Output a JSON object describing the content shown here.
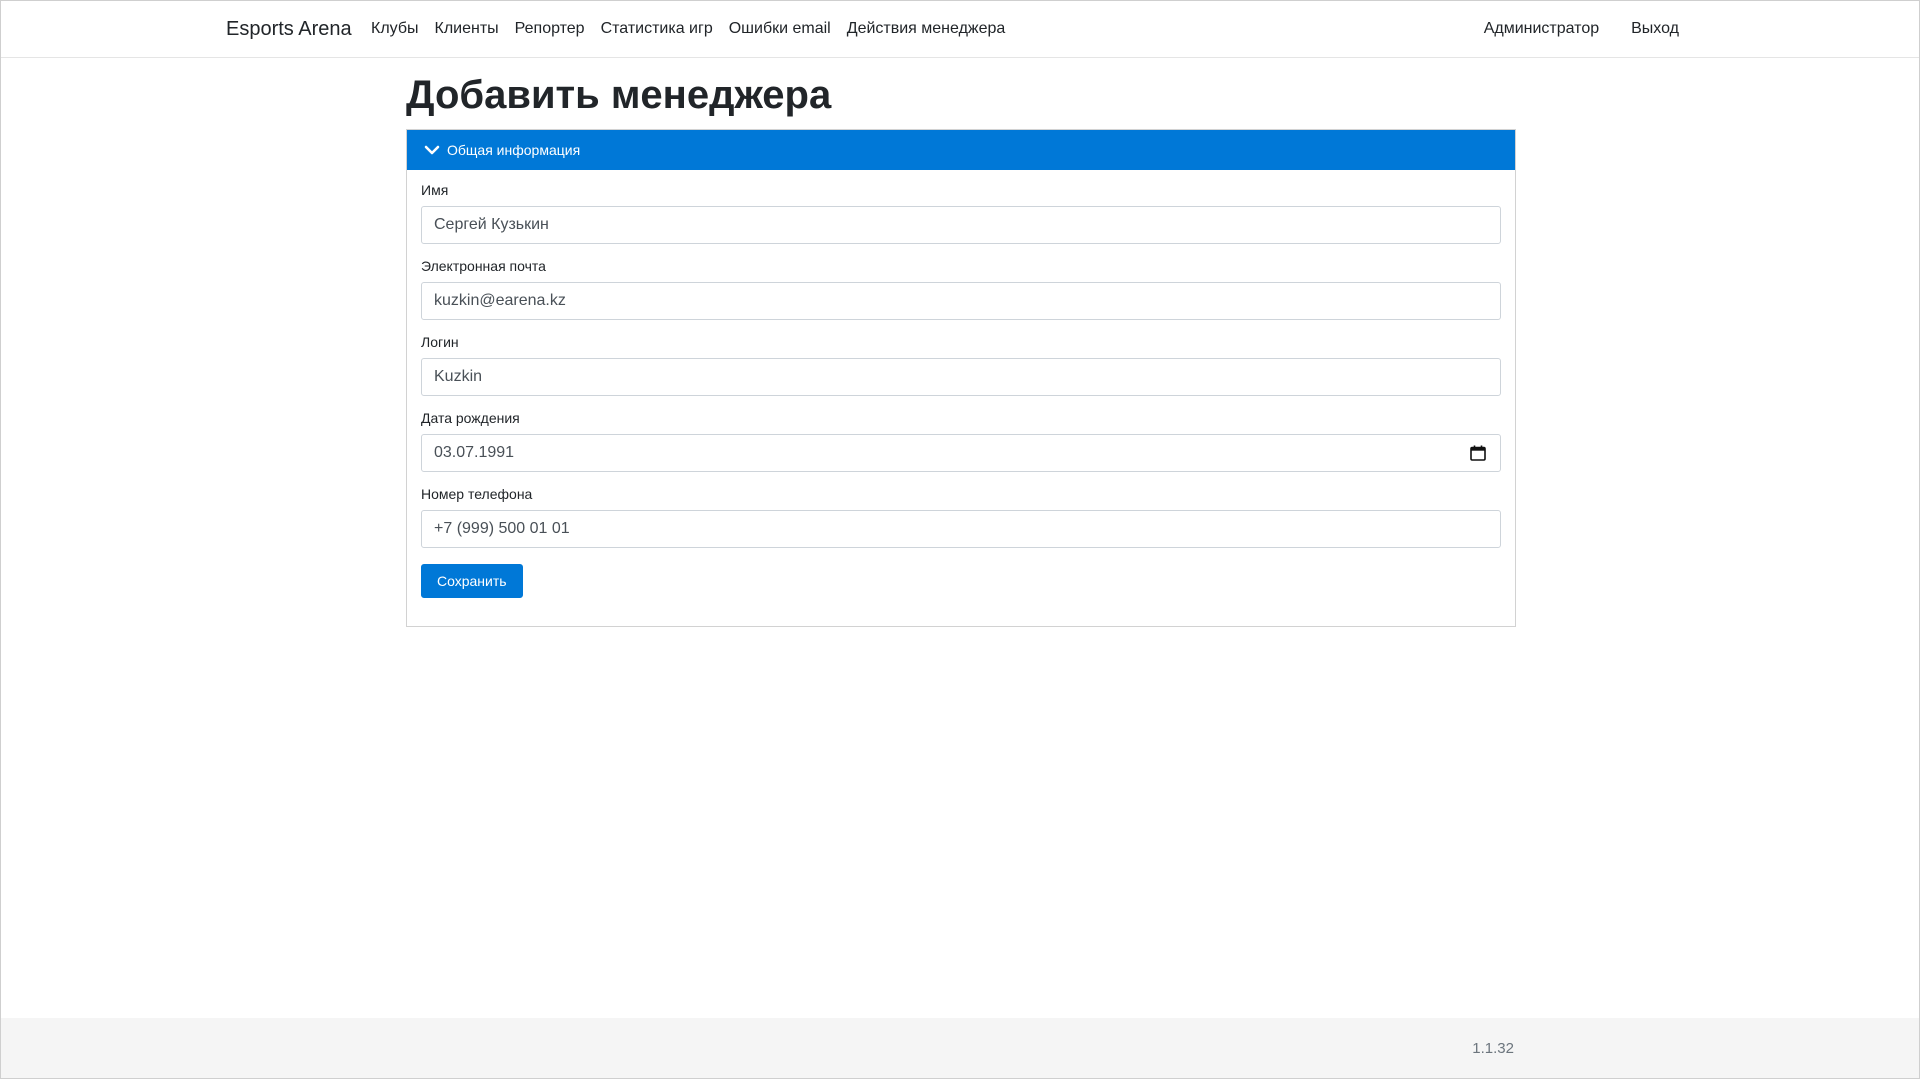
{
  "navbar": {
    "brand": "Esports Arena",
    "links": [
      "Клубы",
      "Клиенты",
      "Репортер",
      "Статистика игр",
      "Ошибки email",
      "Действия менеджера"
    ],
    "right_links": [
      "Администратор",
      "Выход"
    ]
  },
  "page": {
    "title": "Добавить менеджера"
  },
  "card": {
    "header_label": "Общая информация",
    "header_icon": "chevron-down-icon",
    "header_color": "#0078d7"
  },
  "form": {
    "name": {
      "label": "Имя",
      "value": "Сергей Кузькин"
    },
    "email": {
      "label": "Электронная почта",
      "value": "kuzkin@earena.kz"
    },
    "login": {
      "label": "Логин",
      "value": "Kuzkin"
    },
    "birth_date": {
      "label": "Дата рождения",
      "value": "03.07.1991",
      "icon": "calendar-icon"
    },
    "phone": {
      "label": "Номер телефона",
      "value": "+7 (999) 500 01 01"
    },
    "save_label": "Сохранить"
  },
  "footer": {
    "version": "1.1.32"
  }
}
